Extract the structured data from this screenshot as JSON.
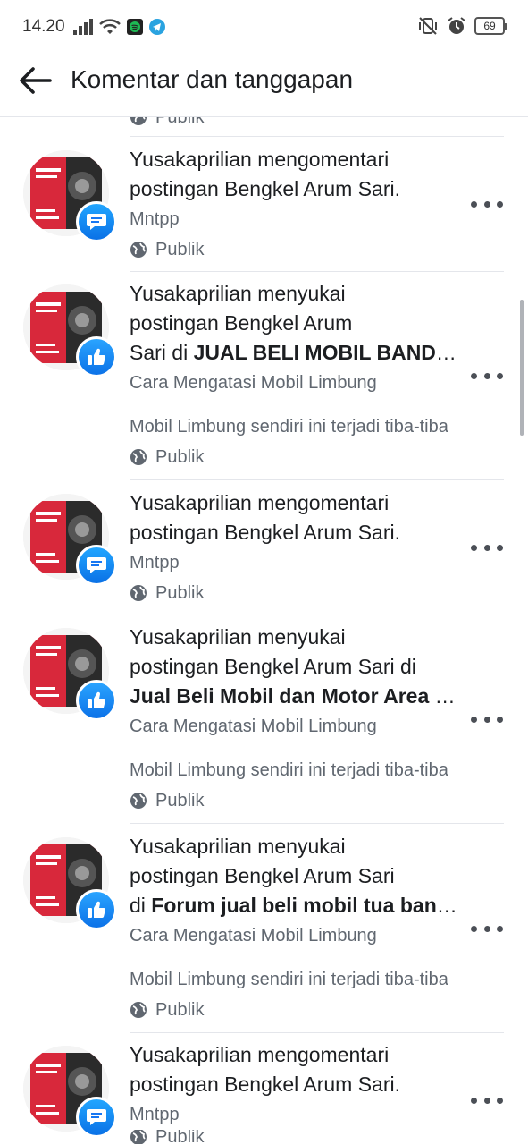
{
  "status_bar": {
    "time": "14.20",
    "battery": "69"
  },
  "header": {
    "title": "Komentar dan tanggapan"
  },
  "items": [
    {
      "line1": "",
      "line2": "",
      "line3_pre": "",
      "line3_bold": "",
      "sub1": "",
      "sub2": "",
      "privacy": "Publik"
    },
    {
      "line1": "Yusakaprilian mengomentari",
      "line2": "postingan Bengkel Arum Sari.",
      "line3_pre": "",
      "line3_bold": "",
      "sub1": "Mntpp",
      "sub2": "",
      "privacy": "Publik"
    },
    {
      "line1": "Yusakaprilian menyukai",
      "line2": "postingan Bengkel Arum",
      "line3_pre": "Sari di ",
      "line3_bold": "JUAL BELI MOBIL BANDUNG",
      "sub1": "Cara Mengatasi Mobil Limbung",
      "sub2": "Mobil Limbung sendiri ini terjadi tiba-tiba",
      "privacy": "Publik"
    },
    {
      "line1": "Yusakaprilian mengomentari",
      "line2": "postingan Bengkel Arum Sari.",
      "line3_pre": "",
      "line3_bold": "",
      "sub1": "Mntpp",
      "sub2": "",
      "privacy": "Publik"
    },
    {
      "line1": "Yusakaprilian menyukai",
      "line2": "postingan Bengkel Arum Sari di",
      "line3_pre": "",
      "line3_bold": "Jual Beli Mobil dan Motor Area Bandung",
      "sub1": "Cara Mengatasi Mobil Limbung",
      "sub2": "Mobil Limbung sendiri ini terjadi tiba-tiba",
      "privacy": "Publik"
    },
    {
      "line1": "Yusakaprilian menyukai",
      "line2": "postingan Bengkel Arum Sari",
      "line3_pre": "di ",
      "line3_bold": "Forum jual beli mobil tua bandung",
      "sub1": "Cara Mengatasi Mobil Limbung",
      "sub2": "Mobil Limbung sendiri ini terjadi tiba-tiba",
      "privacy": "Publik"
    },
    {
      "line1": "Yusakaprilian mengomentari",
      "line2": "postingan Bengkel Arum Sari.",
      "line3_pre": "",
      "line3_bold": "",
      "sub1": "Mntpp",
      "sub2": "",
      "privacy": "Publik"
    }
  ],
  "icons": {
    "comment_badge": "comment-badge-icon",
    "like_badge": "like-badge-icon",
    "globe": "globe-icon",
    "more": "more-options-icon",
    "back": "back-arrow-icon"
  },
  "colors": {
    "badge_blue": "#1877f2",
    "thumb_red": "#d8283b"
  }
}
